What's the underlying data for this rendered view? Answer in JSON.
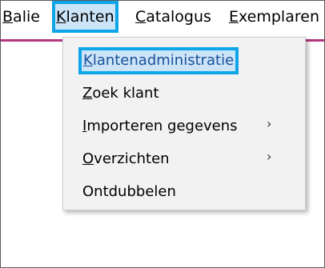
{
  "menubar": {
    "items": [
      {
        "label": "Balie",
        "mnemonic": "B",
        "rest": "alie"
      },
      {
        "label": "Klanten",
        "mnemonic": "K",
        "rest": "lanten",
        "active": true
      },
      {
        "label": "Catalogus",
        "mnemonic": "C",
        "rest": "atalogus"
      },
      {
        "label": "Exemplaren",
        "mnemonic": "E",
        "rest": "xemplaren"
      }
    ]
  },
  "dropdown": {
    "items": [
      {
        "label": "Klantenadministratie",
        "mnemonic": "K",
        "rest": "lantenadministratie",
        "highlighted": true
      },
      {
        "label": "Zoek klant",
        "mnemonic": "Z",
        "rest": "oek klant"
      },
      {
        "label": "Importeren gegevens",
        "mnemonic": "I",
        "rest": "mporteren gegevens",
        "submenu": true
      },
      {
        "label": "Overzichten",
        "mnemonic": "O",
        "rest": "verzichten",
        "submenu": true
      },
      {
        "label": "Ontdubbelen",
        "mnemonic": "",
        "rest": "Ontdubbelen"
      }
    ],
    "submenu_glyph": "›"
  },
  "colors": {
    "accent_strip": "#b3367e",
    "highlight_outline": "#0ea5e9",
    "highlight_fill": "#cce4f7"
  }
}
